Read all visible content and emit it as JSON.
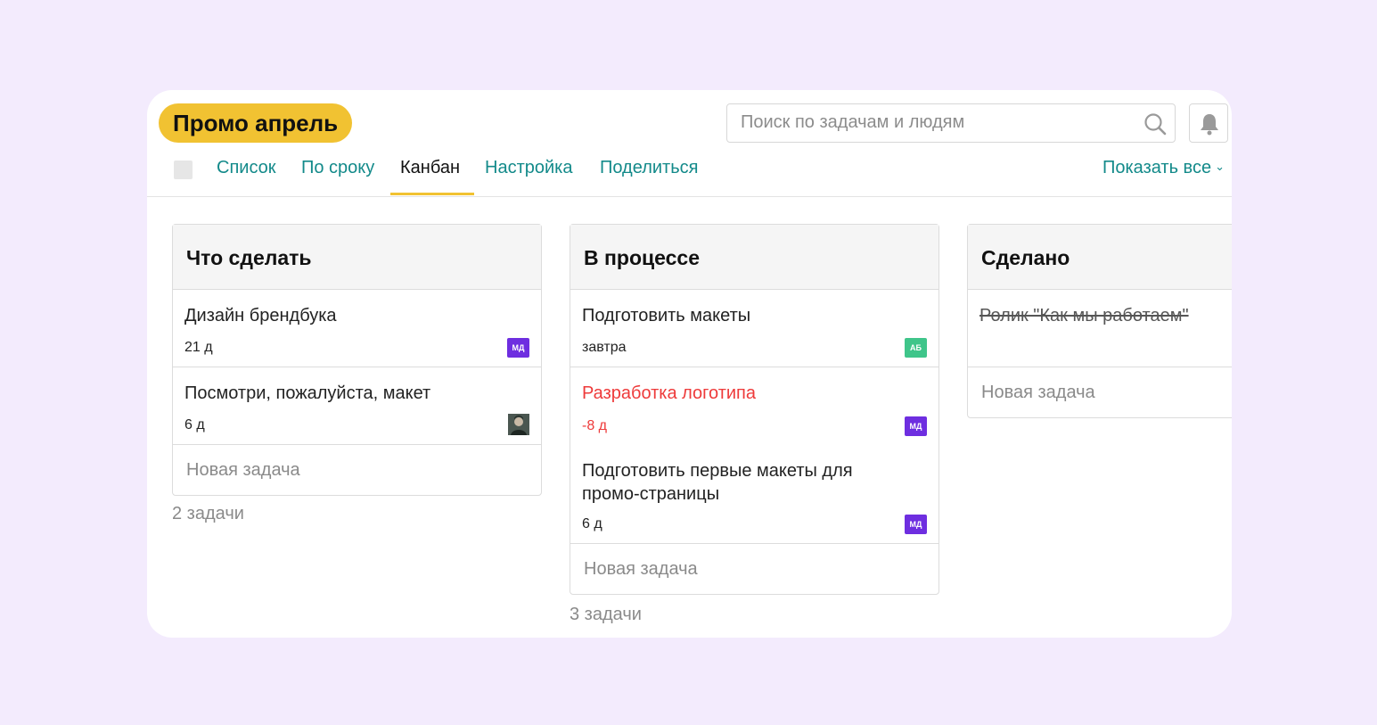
{
  "project": {
    "title": "Промо апрель"
  },
  "search": {
    "placeholder": "Поиск по задачам и людям"
  },
  "nav": {
    "tabs": [
      {
        "label": "Список"
      },
      {
        "label": "По сроку"
      },
      {
        "label": "Канбан"
      },
      {
        "label": "Настройка"
      },
      {
        "label": "Поделиться"
      }
    ],
    "active_tab": "Канбан",
    "show_all_label": "Показать все"
  },
  "columns": [
    {
      "title": "Что сделать",
      "cards": [
        {
          "title": "Дизайн брендбука",
          "due": "21 д",
          "assignee": "МД"
        },
        {
          "title": "Посмотри, пожалуйста, макет",
          "due": "6 д",
          "assignee": "photo"
        }
      ],
      "new_task_label": "Новая задача",
      "count": "2 задачи"
    },
    {
      "title": "В процессе",
      "cards": [
        {
          "title": "Подготовить макеты",
          "due": "завтра",
          "assignee": "АБ"
        },
        {
          "title": "Разработка логотипа",
          "due": "-8 д",
          "assignee": "МД",
          "overdue": true
        },
        {
          "title": "Подготовить первые макеты для промо-страницы",
          "due": "6 д",
          "assignee": "МД"
        }
      ],
      "new_task_label": "Новая задача",
      "count": "3 задачи"
    },
    {
      "title": "Сделано",
      "cards": [
        {
          "title": "Ролик \"Как мы работаем\"",
          "done": true
        }
      ],
      "new_task_label": "Новая задача"
    }
  ],
  "colors": {
    "accent_yellow": "#f1c232",
    "link_teal": "#138a8a",
    "overdue_red": "#ee3a3a",
    "avatar_purple": "#6e2ee0",
    "avatar_green": "#3fc58a",
    "background": "#f3ebfd"
  },
  "icons": [
    "search-icon",
    "bell-icon",
    "chevron-down-icon"
  ]
}
